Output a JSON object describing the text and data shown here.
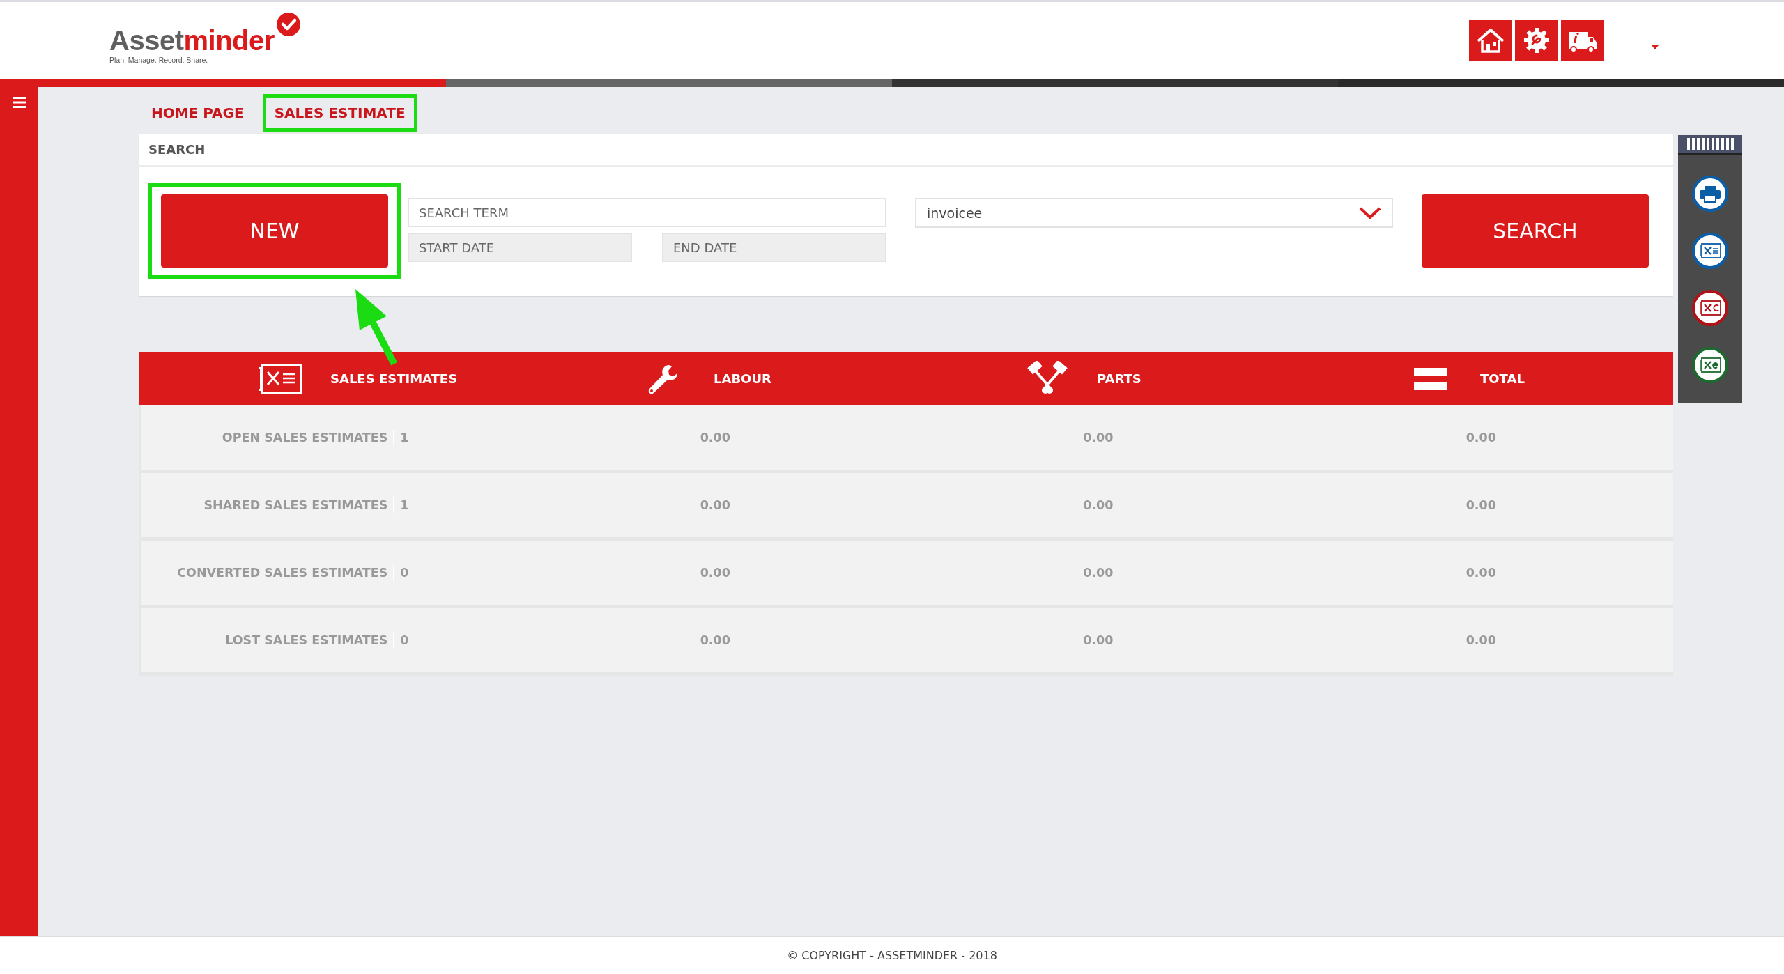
{
  "logo": {
    "part_1": "Asset",
    "part_2": "minder",
    "tagline": "Plan. Manage. Record. Share."
  },
  "header_buttons": [
    {
      "kind": "home"
    },
    {
      "kind": "settings"
    },
    {
      "kind": "truck"
    }
  ],
  "user_menu": {
    "expanded": false
  },
  "breadcrumb": [
    {
      "label": "HOME PAGE",
      "highlighted": false
    },
    {
      "label": "SALES ESTIMATE",
      "highlighted": true
    }
  ],
  "search_panel": {
    "title": "SEARCH",
    "new_button": {
      "label": "NEW",
      "highlighted": true
    },
    "search_term": {
      "placeholder": "SEARCH TERM"
    },
    "start_date": {
      "placeholder": "START DATE"
    },
    "end_date": {
      "placeholder": "END DATE"
    },
    "filter": {
      "value": "invoicee"
    },
    "search_button": {
      "label": "SEARCH"
    }
  },
  "annotation_arrow": true,
  "side_toolbar": [
    {
      "kind": "print",
      "color": "#0a5ea8"
    },
    {
      "kind": "estimate",
      "color": "#0a5ea8"
    },
    {
      "kind": "convert",
      "color": "#b01217"
    },
    {
      "kind": "export",
      "color": "#1c6b2e"
    }
  ],
  "table": {
    "columns": [
      {
        "label": "SALES ESTIMATES",
        "kind": "estimate"
      },
      {
        "label": "LABOUR",
        "kind": "wrench"
      },
      {
        "label": "PARTS",
        "kind": "pistons"
      },
      {
        "label": "TOTAL",
        "kind": "equals"
      }
    ],
    "rows": [
      {
        "label": "OPEN SALES ESTIMATES",
        "count": "1",
        "labour": "0.00",
        "parts": "0.00",
        "total": "0.00"
      },
      {
        "label": "SHARED SALES ESTIMATES",
        "count": "1",
        "labour": "0.00",
        "parts": "0.00",
        "total": "0.00"
      },
      {
        "label": "CONVERTED SALES ESTIMATES",
        "count": "0",
        "labour": "0.00",
        "parts": "0.00",
        "total": "0.00"
      },
      {
        "label": "LOST SALES ESTIMATES",
        "count": "0",
        "labour": "0.00",
        "parts": "0.00",
        "total": "0.00"
      }
    ]
  },
  "footer": "© COPYRIGHT - ASSETMINDER - 2018"
}
